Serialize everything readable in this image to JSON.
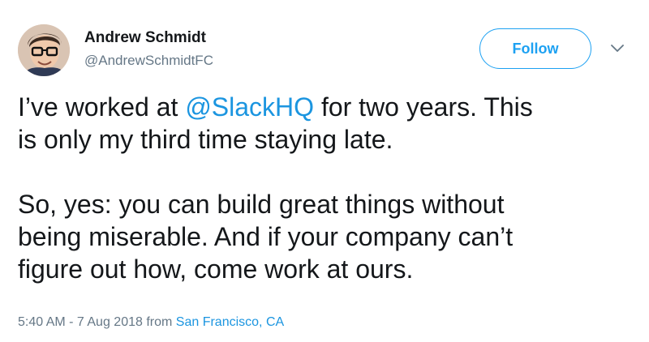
{
  "user": {
    "name": "Andrew Schmidt",
    "handle": "@AndrewSchmidtFC"
  },
  "follow_label": "Follow",
  "icons": {
    "menu": "chevron-down-icon",
    "avatar": "avatar"
  },
  "tweet": {
    "line1_before": "I’ve worked at ",
    "line1_mention": "@SlackHQ",
    "line1_after": " for two years. This",
    "line2": "is only my third time staying late.",
    "line3": "So, yes: you can build great things without",
    "line4": "being miserable. And if your company can’t",
    "line5": "figure out how, come work at ours."
  },
  "meta": {
    "timestamp": "5:40 AM - 7 Aug 2018",
    "from_label": " from ",
    "location": "San Francisco, CA"
  },
  "colors": {
    "accent": "#1da1f2",
    "link": "#1b95e0",
    "secondary_text": "#657786",
    "primary_text": "#14171a"
  }
}
